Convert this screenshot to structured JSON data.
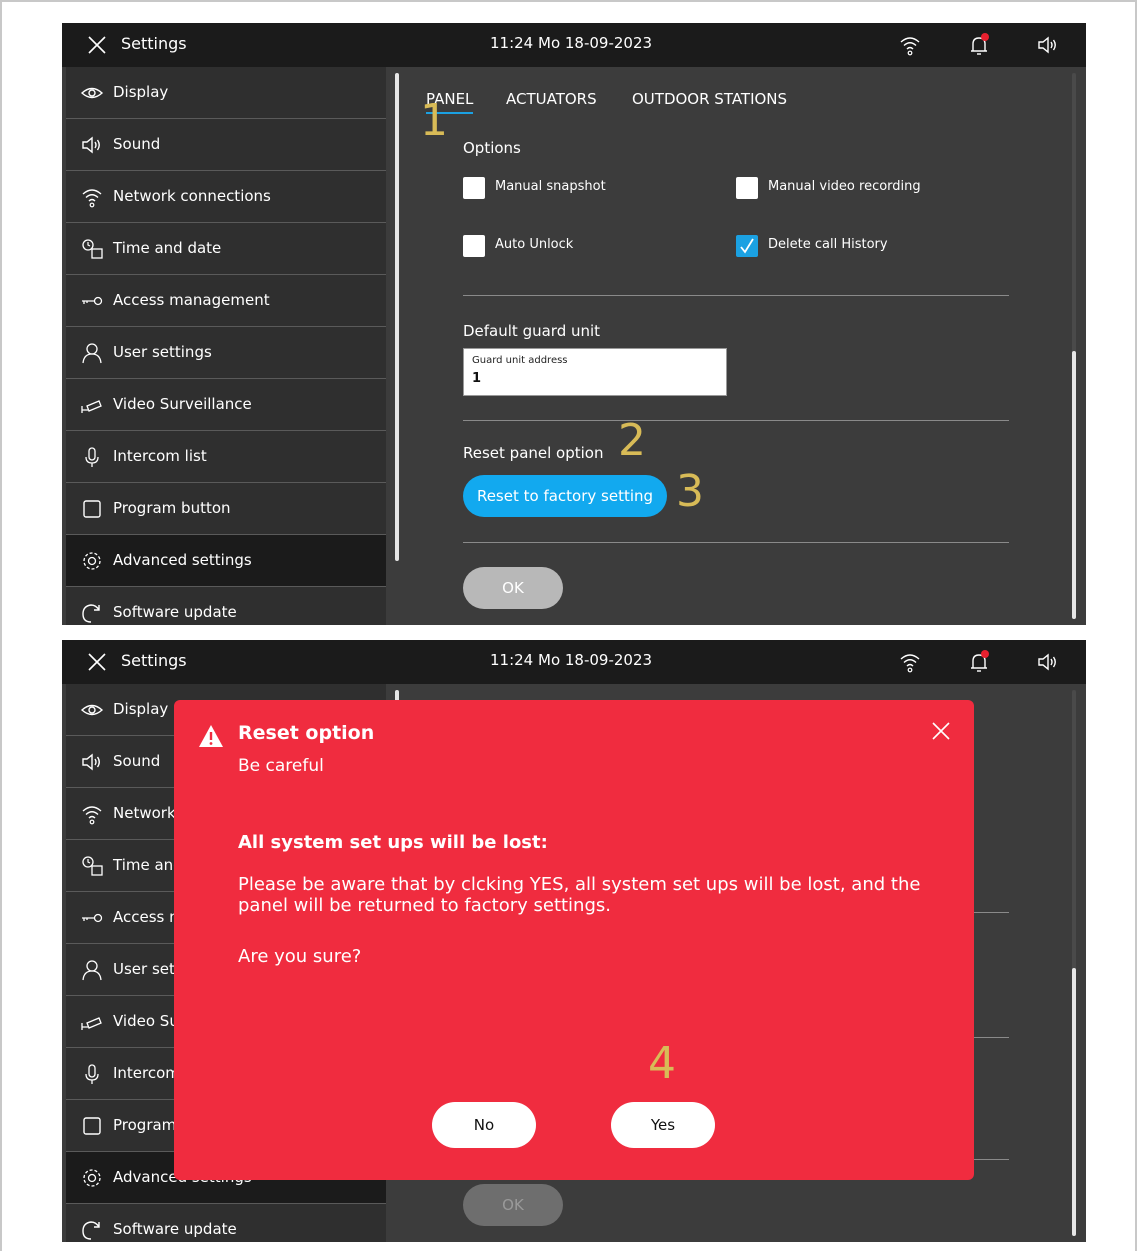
{
  "topbar": {
    "title": "Settings",
    "clock": "11:24  Mo 18-09-2023",
    "icons": [
      "close-icon",
      "wifi-icon",
      "bell-icon",
      "speaker-icon"
    ],
    "notification_dot_color": "#e8202f"
  },
  "sidebar": {
    "items": [
      {
        "label": "Display",
        "icon": "eye-icon"
      },
      {
        "label": "Sound",
        "icon": "speaker-icon"
      },
      {
        "label": "Network connections",
        "icon": "wifi-icon"
      },
      {
        "label": "Time and date",
        "icon": "clock-calendar-icon"
      },
      {
        "label": "Access  management",
        "icon": "key-icon"
      },
      {
        "label": "User settings",
        "icon": "user-icon"
      },
      {
        "label": "Video Surveillance",
        "icon": "camera-icon"
      },
      {
        "label": "Intercom list",
        "icon": "microphone-icon"
      },
      {
        "label": "Program button",
        "icon": "square-icon"
      },
      {
        "label": "Advanced settings",
        "icon": "gear-icon",
        "active": true
      },
      {
        "label": "Software update",
        "icon": "refresh-icon"
      }
    ]
  },
  "tabs": [
    {
      "label": "PANEL",
      "active": true
    },
    {
      "label": "ACTUATORS"
    },
    {
      "label": "OUTDOOR STATIONS"
    }
  ],
  "options": {
    "title": "Options",
    "manual_snapshot": {
      "label": "Manual snapshot",
      "checked": false
    },
    "manual_video": {
      "label": "Manual video recording",
      "checked": false
    },
    "auto_unlock": {
      "label": "Auto Unlock",
      "checked": false
    },
    "delete_history": {
      "label": "Delete call History",
      "checked": true
    }
  },
  "guard": {
    "title": "Default guard unit",
    "input_label": "Guard unit address",
    "input_value": "1"
  },
  "reset": {
    "title": "Reset panel option",
    "button": "Reset to factory setting"
  },
  "ok_button": "OK",
  "steps": {
    "s1": "1",
    "s2": "2",
    "s3": "3",
    "s4": "4"
  },
  "modal": {
    "title": "Reset option",
    "subtitle": "Be careful",
    "heading": "All system set ups will be lost:",
    "body": "Please be aware that by clcking YES, all system set ups will be lost, and the panel will be returned to factory settings.",
    "question": "Are you sure?",
    "no": "No",
    "yes": "Yes",
    "color": "#f02c3f"
  },
  "colors": {
    "accent": "#12a9ef",
    "annotation": "#d8bb57"
  }
}
